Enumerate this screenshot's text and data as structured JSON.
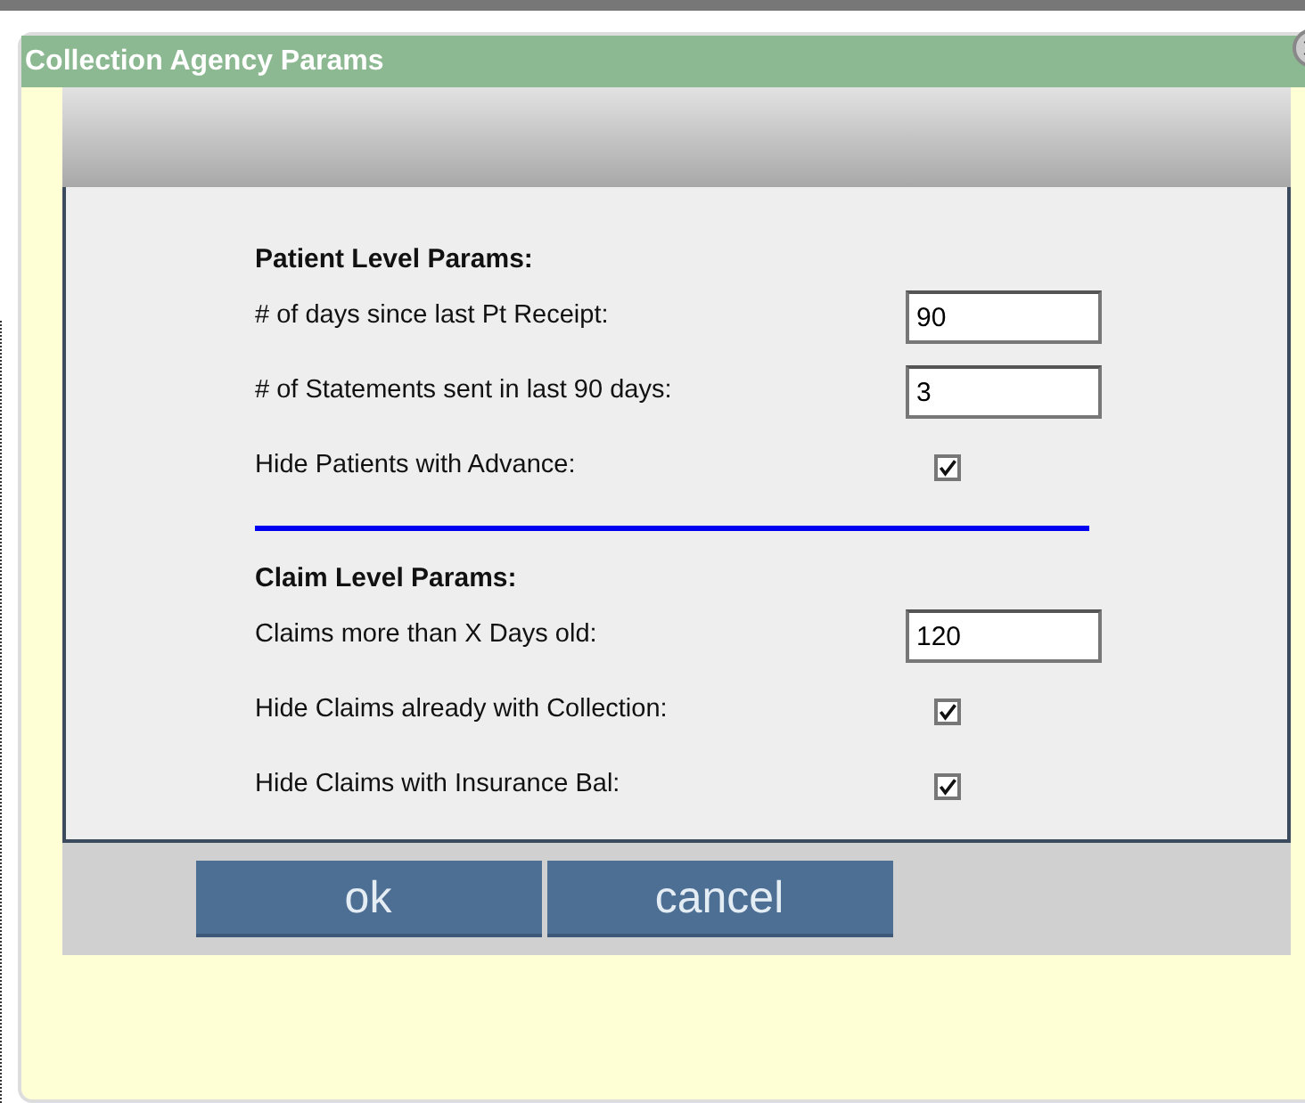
{
  "dialog": {
    "title": "Collection Agency Params"
  },
  "sections": [
    {
      "title": "Patient Level Params:",
      "fields": [
        {
          "kind": "text",
          "label": "# of days since last Pt Receipt:",
          "value": "90"
        },
        {
          "kind": "text",
          "label": "# of Statements sent in last 90  days:",
          "value": "3"
        },
        {
          "kind": "checkbox",
          "label": "Hide Patients with Advance:",
          "checked": true
        }
      ]
    },
    {
      "title": "Claim Level Params:",
      "fields": [
        {
          "kind": "text",
          "label": "Claims more than X Days old:",
          "value": "120"
        },
        {
          "kind": "checkbox",
          "label": "Hide Claims already with Collection:",
          "checked": true
        },
        {
          "kind": "checkbox",
          "label": "Hide Claims with Insurance Bal:",
          "checked": true
        }
      ]
    }
  ],
  "buttons": [
    "ok",
    "cancel"
  ]
}
